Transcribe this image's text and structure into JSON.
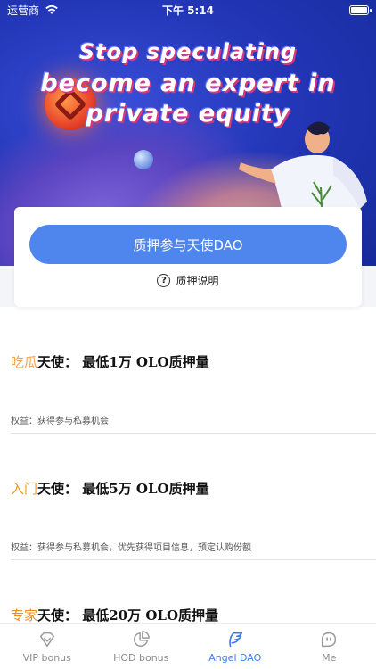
{
  "status_bar": {
    "carrier": "运营商",
    "time": "下午 5:14"
  },
  "banner": {
    "line1": "Stop speculating",
    "line2": "become an expert in",
    "line3": "private equity"
  },
  "stake": {
    "button_label": "质押参与天使DAO",
    "help_label": "质押说明"
  },
  "tiers": [
    {
      "tag": "吃瓜",
      "title": "天使：  最低1万 OLO质押量",
      "benefit": "权益：获得参与私募机会"
    },
    {
      "tag": "入门",
      "title": "天使：  最低5万 OLO质押量",
      "benefit": "权益：获得参与私募机会，优先获得项目信息，预定认购份额"
    },
    {
      "tag": "专家",
      "title": "天使：  最低20万 OLO质押量",
      "benefit": ""
    }
  ],
  "tabbar": {
    "items": [
      {
        "label": "VIP bonus",
        "icon": "diamond-icon",
        "active": false
      },
      {
        "label": "HOD bonus",
        "icon": "pie-chart-icon",
        "active": false
      },
      {
        "label": "Angel DAO",
        "icon": "angel-wings-icon",
        "active": true
      },
      {
        "label": "Me",
        "icon": "face-icon",
        "active": false
      }
    ]
  },
  "colors": {
    "accent": "#4f86ee",
    "tab_active": "#3f7be8",
    "tier_tag": "#f5a24a"
  }
}
